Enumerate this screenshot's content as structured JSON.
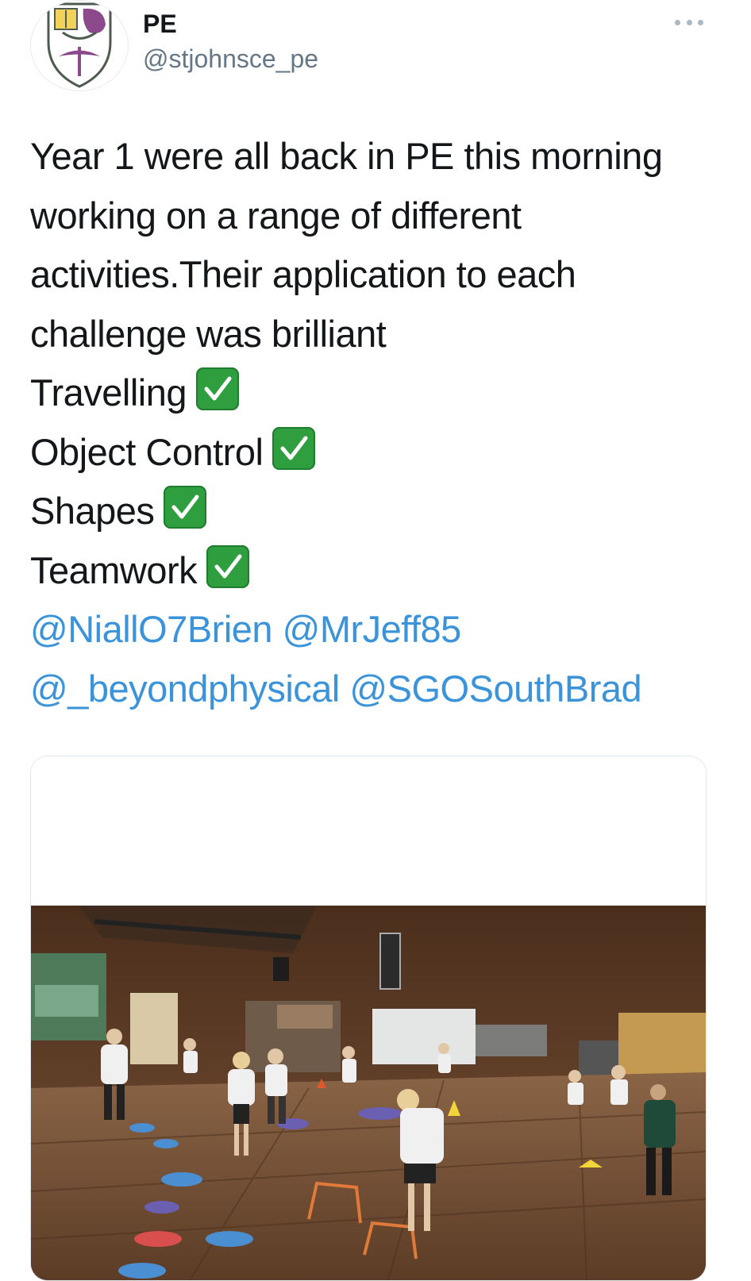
{
  "tweet": {
    "author": {
      "display_name": "PE",
      "handle": "@stjohnsce_pe",
      "avatar_icon": "school-crest-icon"
    },
    "more_icon": "more-options-icon",
    "text_lines": [
      "Year 1 were all back in PE this morning",
      "working on a range of different",
      "activities.Their application to each",
      "challenge was brilliant"
    ],
    "checklist": [
      {
        "label": "Travelling",
        "icon": "check-mark-icon"
      },
      {
        "label": "Object Control",
        "icon": "check-mark-icon"
      },
      {
        "label": "Shapes",
        "icon": "check-mark-icon"
      },
      {
        "label": "Teamwork",
        "icon": "check-mark-icon"
      }
    ],
    "mentions_line1": [
      "@NiallO7Brien",
      "@MrJeff85"
    ],
    "mentions_line2": [
      "@_beyondphysical",
      "@SGOSouthBrad"
    ]
  },
  "media": {
    "description_icon": "video-thumbnail-icon"
  },
  "colors": {
    "text": "#14171a",
    "secondary": "#657786",
    "link": "#3b94d9",
    "check_green": "#2e9e3f",
    "border": "#e1e8ed"
  }
}
